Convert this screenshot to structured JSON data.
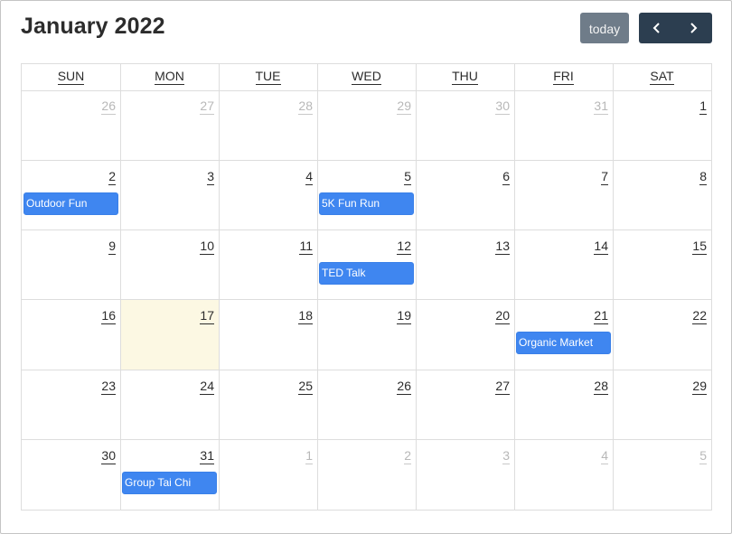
{
  "header": {
    "title": "January 2022",
    "today_label": "today",
    "prev_icon": "chevron-left-icon",
    "next_icon": "chevron-right-icon"
  },
  "colors": {
    "today_button": "#6f7c89",
    "nav_button": "#2c3e50",
    "event": "#3f86f0",
    "today_cell": "#fcf8e3"
  },
  "weekdays": [
    "SUN",
    "MON",
    "TUE",
    "WED",
    "THU",
    "FRI",
    "SAT"
  ],
  "weeks": [
    [
      {
        "day": "26",
        "other": true
      },
      {
        "day": "27",
        "other": true
      },
      {
        "day": "28",
        "other": true
      },
      {
        "day": "29",
        "other": true
      },
      {
        "day": "30",
        "other": true
      },
      {
        "day": "31",
        "other": true
      },
      {
        "day": "1"
      }
    ],
    [
      {
        "day": "2",
        "event": "Outdoor Fun"
      },
      {
        "day": "3"
      },
      {
        "day": "4"
      },
      {
        "day": "5",
        "event": "5K Fun Run"
      },
      {
        "day": "6"
      },
      {
        "day": "7"
      },
      {
        "day": "8"
      }
    ],
    [
      {
        "day": "9"
      },
      {
        "day": "10"
      },
      {
        "day": "11"
      },
      {
        "day": "12",
        "event": "TED Talk"
      },
      {
        "day": "13"
      },
      {
        "day": "14"
      },
      {
        "day": "15"
      }
    ],
    [
      {
        "day": "16"
      },
      {
        "day": "17",
        "today": true
      },
      {
        "day": "18"
      },
      {
        "day": "19"
      },
      {
        "day": "20"
      },
      {
        "day": "21",
        "event": "Organic Market"
      },
      {
        "day": "22"
      }
    ],
    [
      {
        "day": "23"
      },
      {
        "day": "24"
      },
      {
        "day": "25"
      },
      {
        "day": "26"
      },
      {
        "day": "27"
      },
      {
        "day": "28"
      },
      {
        "day": "29"
      }
    ],
    [
      {
        "day": "30"
      },
      {
        "day": "31",
        "event": "Group Tai Chi"
      },
      {
        "day": "1",
        "other": true
      },
      {
        "day": "2",
        "other": true
      },
      {
        "day": "3",
        "other": true
      },
      {
        "day": "4",
        "other": true
      },
      {
        "day": "5",
        "other": true
      }
    ]
  ]
}
